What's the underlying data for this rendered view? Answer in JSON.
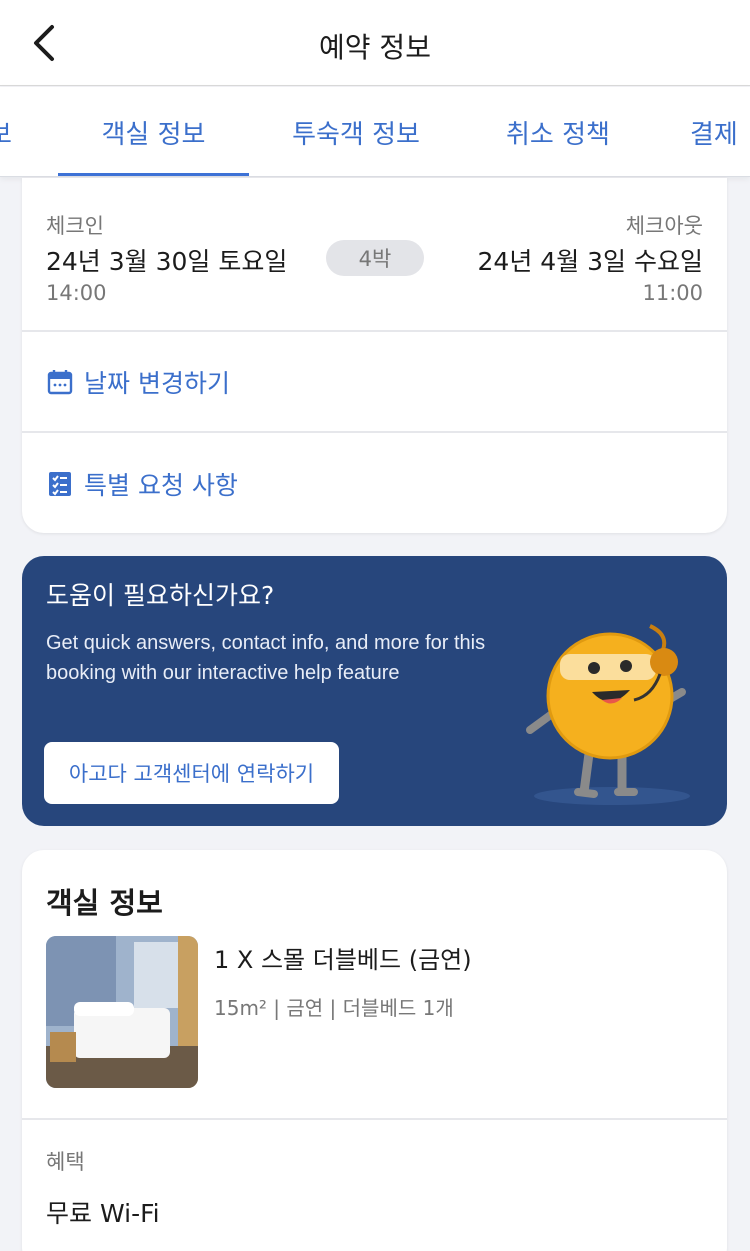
{
  "header": {
    "title": "예약 정보"
  },
  "tabs": [
    {
      "label": "보"
    },
    {
      "label": "객실 정보"
    },
    {
      "label": "투숙객 정보"
    },
    {
      "label": "취소 정책"
    },
    {
      "label": "결제"
    }
  ],
  "stay": {
    "checkin_label": "체크인",
    "checkin_date": "24년 3월 30일 토요일",
    "checkin_time": "14:00",
    "nights": "4박",
    "checkout_label": "체크아웃",
    "checkout_date": "24년 4월 3일 수요일",
    "checkout_time": "11:00",
    "change_dates_label": "날짜 변경하기",
    "special_requests_label": "특별 요청 사항"
  },
  "help": {
    "title": "도움이 필요하신가요?",
    "description": "Get quick answers, contact info, and more for this booking with our interactive help feature",
    "button_label": "아고다 고객센터에 연락하기"
  },
  "room": {
    "heading": "객실 정보",
    "name": "1 X 스몰 더블베드 (금연)",
    "meta": "15m² | 금연 | 더블베드 1개",
    "benefits_label": "혜택",
    "benefit": "무료 Wi-Fi"
  },
  "colors": {
    "accent": "#3b6fcb",
    "banner": "#27467c",
    "mascot": "#f5b01e"
  }
}
